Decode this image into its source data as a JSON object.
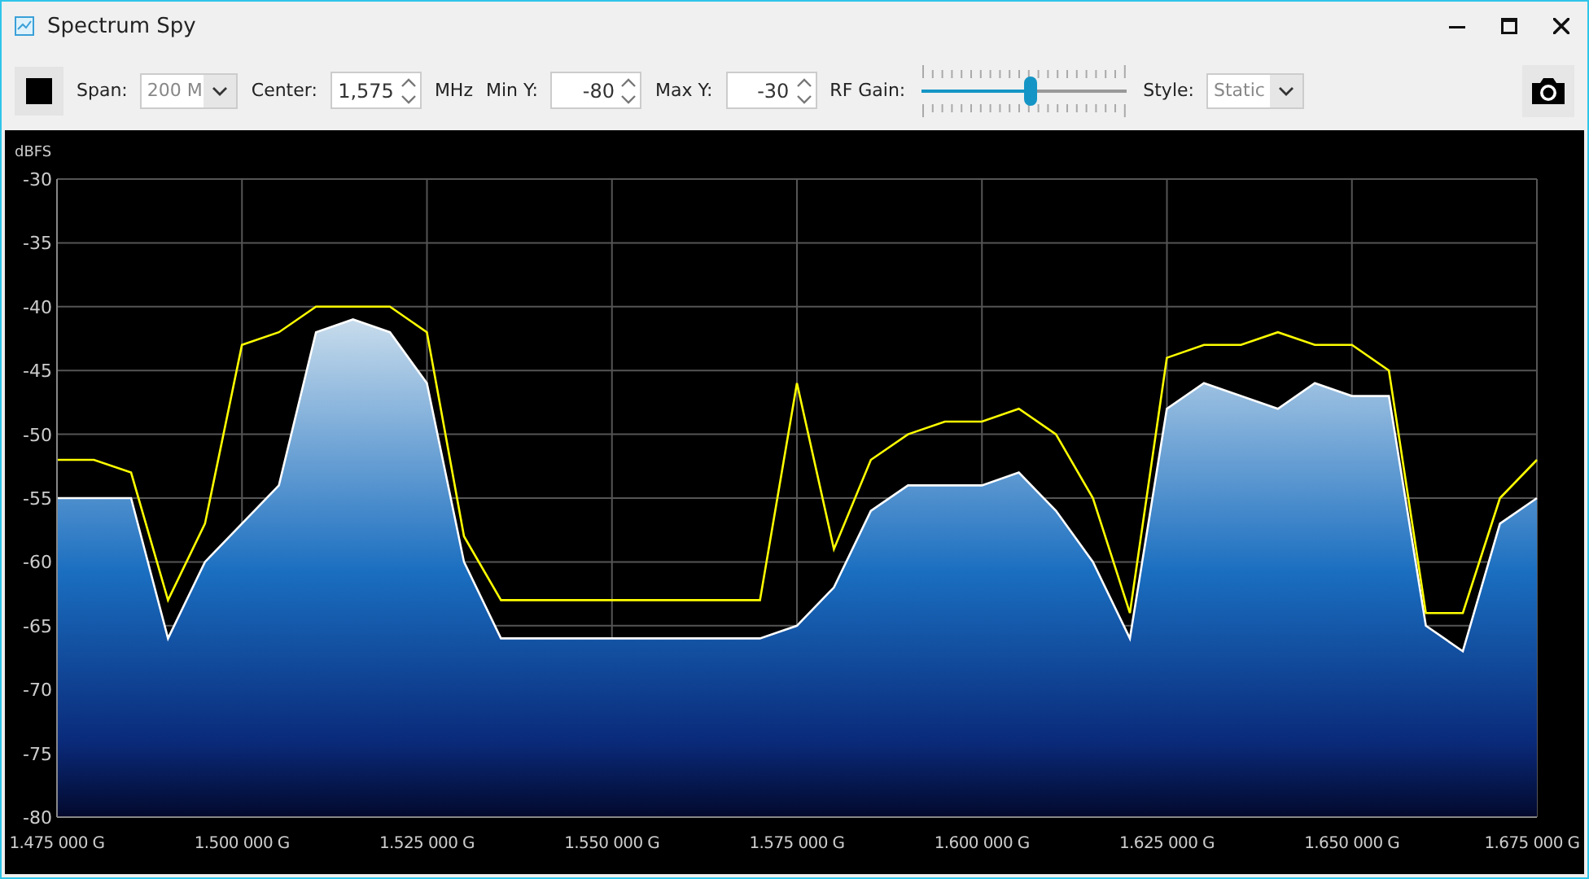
{
  "window": {
    "title": "Spectrum Spy"
  },
  "toolbar": {
    "color_swatch": {
      "color": "#000000"
    },
    "span": {
      "label": "Span:",
      "value": "200 M"
    },
    "center": {
      "label": "Center:",
      "value": "1,575",
      "unit": "MHz"
    },
    "min_y": {
      "label": "Min Y:",
      "value": "-80"
    },
    "max_y": {
      "label": "Max Y:",
      "value": "-30"
    },
    "rf_gain": {
      "label": "RF Gain:",
      "level": 0.53
    },
    "style": {
      "label": "Style:",
      "value": "Static"
    }
  },
  "spectrum": {
    "chart_data": {
      "type": "area",
      "ylabel": "dBFS",
      "xlim": [
        1.475,
        1.675
      ],
      "ylim": [
        -80,
        -30
      ],
      "x": [
        1.475,
        1.48,
        1.485,
        1.49,
        1.495,
        1.5,
        1.505,
        1.51,
        1.515,
        1.52,
        1.525,
        1.53,
        1.535,
        1.54,
        1.545,
        1.55,
        1.555,
        1.56,
        1.565,
        1.57,
        1.575,
        1.58,
        1.585,
        1.59,
        1.595,
        1.6,
        1.605,
        1.61,
        1.615,
        1.62,
        1.625,
        1.63,
        1.635,
        1.64,
        1.645,
        1.65,
        1.655,
        1.66,
        1.665,
        1.67,
        1.675
      ],
      "series": [
        {
          "color": "#ffff00",
          "type": "line",
          "values": [
            -52,
            -52,
            -53,
            -63,
            -57,
            -43,
            -42,
            -40,
            -40,
            -40,
            -42,
            -58,
            -63,
            -63,
            -63,
            -63,
            -63,
            -63,
            -63,
            -63,
            -46,
            -59,
            -52,
            -50,
            -49,
            -49,
            -48,
            -50,
            -55,
            -64,
            -44,
            -43,
            -43,
            -42,
            -43,
            -43,
            -45,
            -64,
            -64,
            -55,
            -52
          ]
        },
        {
          "color": "#ffffff",
          "type": "area",
          "values": [
            -55,
            -55,
            -55,
            -66,
            -60,
            -57,
            -54,
            -42,
            -41,
            -42,
            -46,
            -60,
            -66,
            -66,
            -66,
            -66,
            -66,
            -66,
            -66,
            -66,
            -65,
            -62,
            -56,
            -54,
            -54,
            -54,
            -53,
            -56,
            -60,
            -66,
            -48,
            -46,
            -47,
            -48,
            -46,
            -47,
            -47,
            -65,
            -67,
            -57,
            -55
          ]
        }
      ],
      "xticks": [
        {
          "value": 1.475,
          "label": "1.475 000 G"
        },
        {
          "value": 1.5,
          "label": "1.500 000 G"
        },
        {
          "value": 1.525,
          "label": "1.525 000 G"
        },
        {
          "value": 1.55,
          "label": "1.550 000 G"
        },
        {
          "value": 1.575,
          "label": "1.575 000 G"
        },
        {
          "value": 1.6,
          "label": "1.600 000 G"
        },
        {
          "value": 1.625,
          "label": "1.625 000 G"
        },
        {
          "value": 1.65,
          "label": "1.650 000 G"
        },
        {
          "value": 1.675,
          "label": "1.675 000 G"
        }
      ],
      "yticks": [
        -30,
        -35,
        -40,
        -45,
        -50,
        -55,
        -60,
        -65,
        -70,
        -75,
        -80
      ],
      "grid": true
    }
  }
}
